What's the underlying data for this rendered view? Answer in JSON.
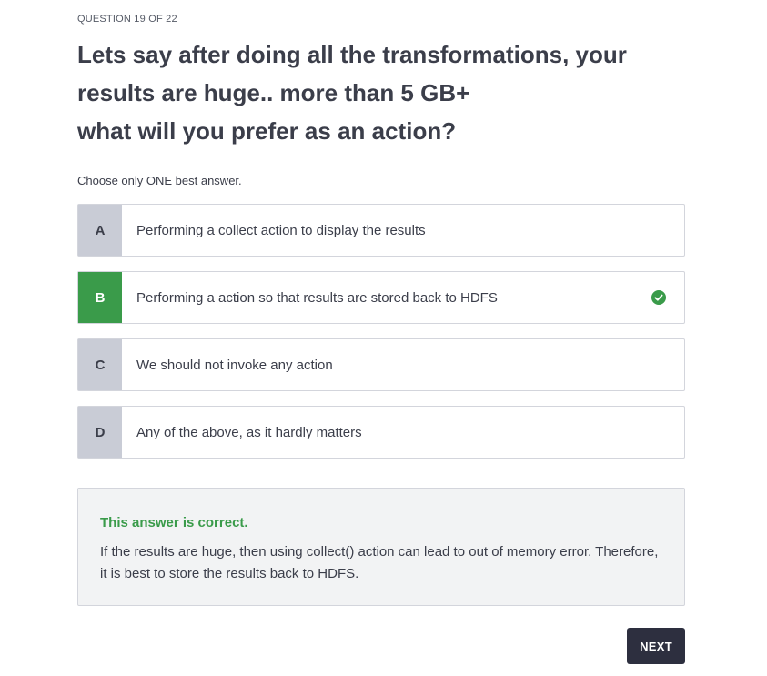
{
  "progress": "QUESTION 19 OF 22",
  "question": "Lets say after doing all the transformations, your\nresults are huge.. more than 5 GB+\nwhat will you prefer as an action?",
  "instruction": "Choose only ONE best answer.",
  "options": [
    {
      "letter": "A",
      "text": "Performing a collect action to display the results",
      "state": "default"
    },
    {
      "letter": "B",
      "text": "Performing a action so that results are stored back to HDFS",
      "state": "correct"
    },
    {
      "letter": "C",
      "text": "We should not invoke any action",
      "state": "default"
    },
    {
      "letter": "D",
      "text": "Any of the above, as it hardly matters",
      "state": "default"
    }
  ],
  "feedback": {
    "title": "This answer is correct.",
    "body": "If the results are huge, then using collect() action can lead to out of memory error. Therefore, it is best to store the results back to HDFS."
  },
  "next_label": "NEXT",
  "colors": {
    "correct": "#3a9b4a",
    "letter_bg": "#c9ccd6",
    "button_bg": "#2d2f3f",
    "feedback_bg": "#f2f3f4"
  },
  "icons": {
    "correct_marker": "check-circle-icon"
  }
}
